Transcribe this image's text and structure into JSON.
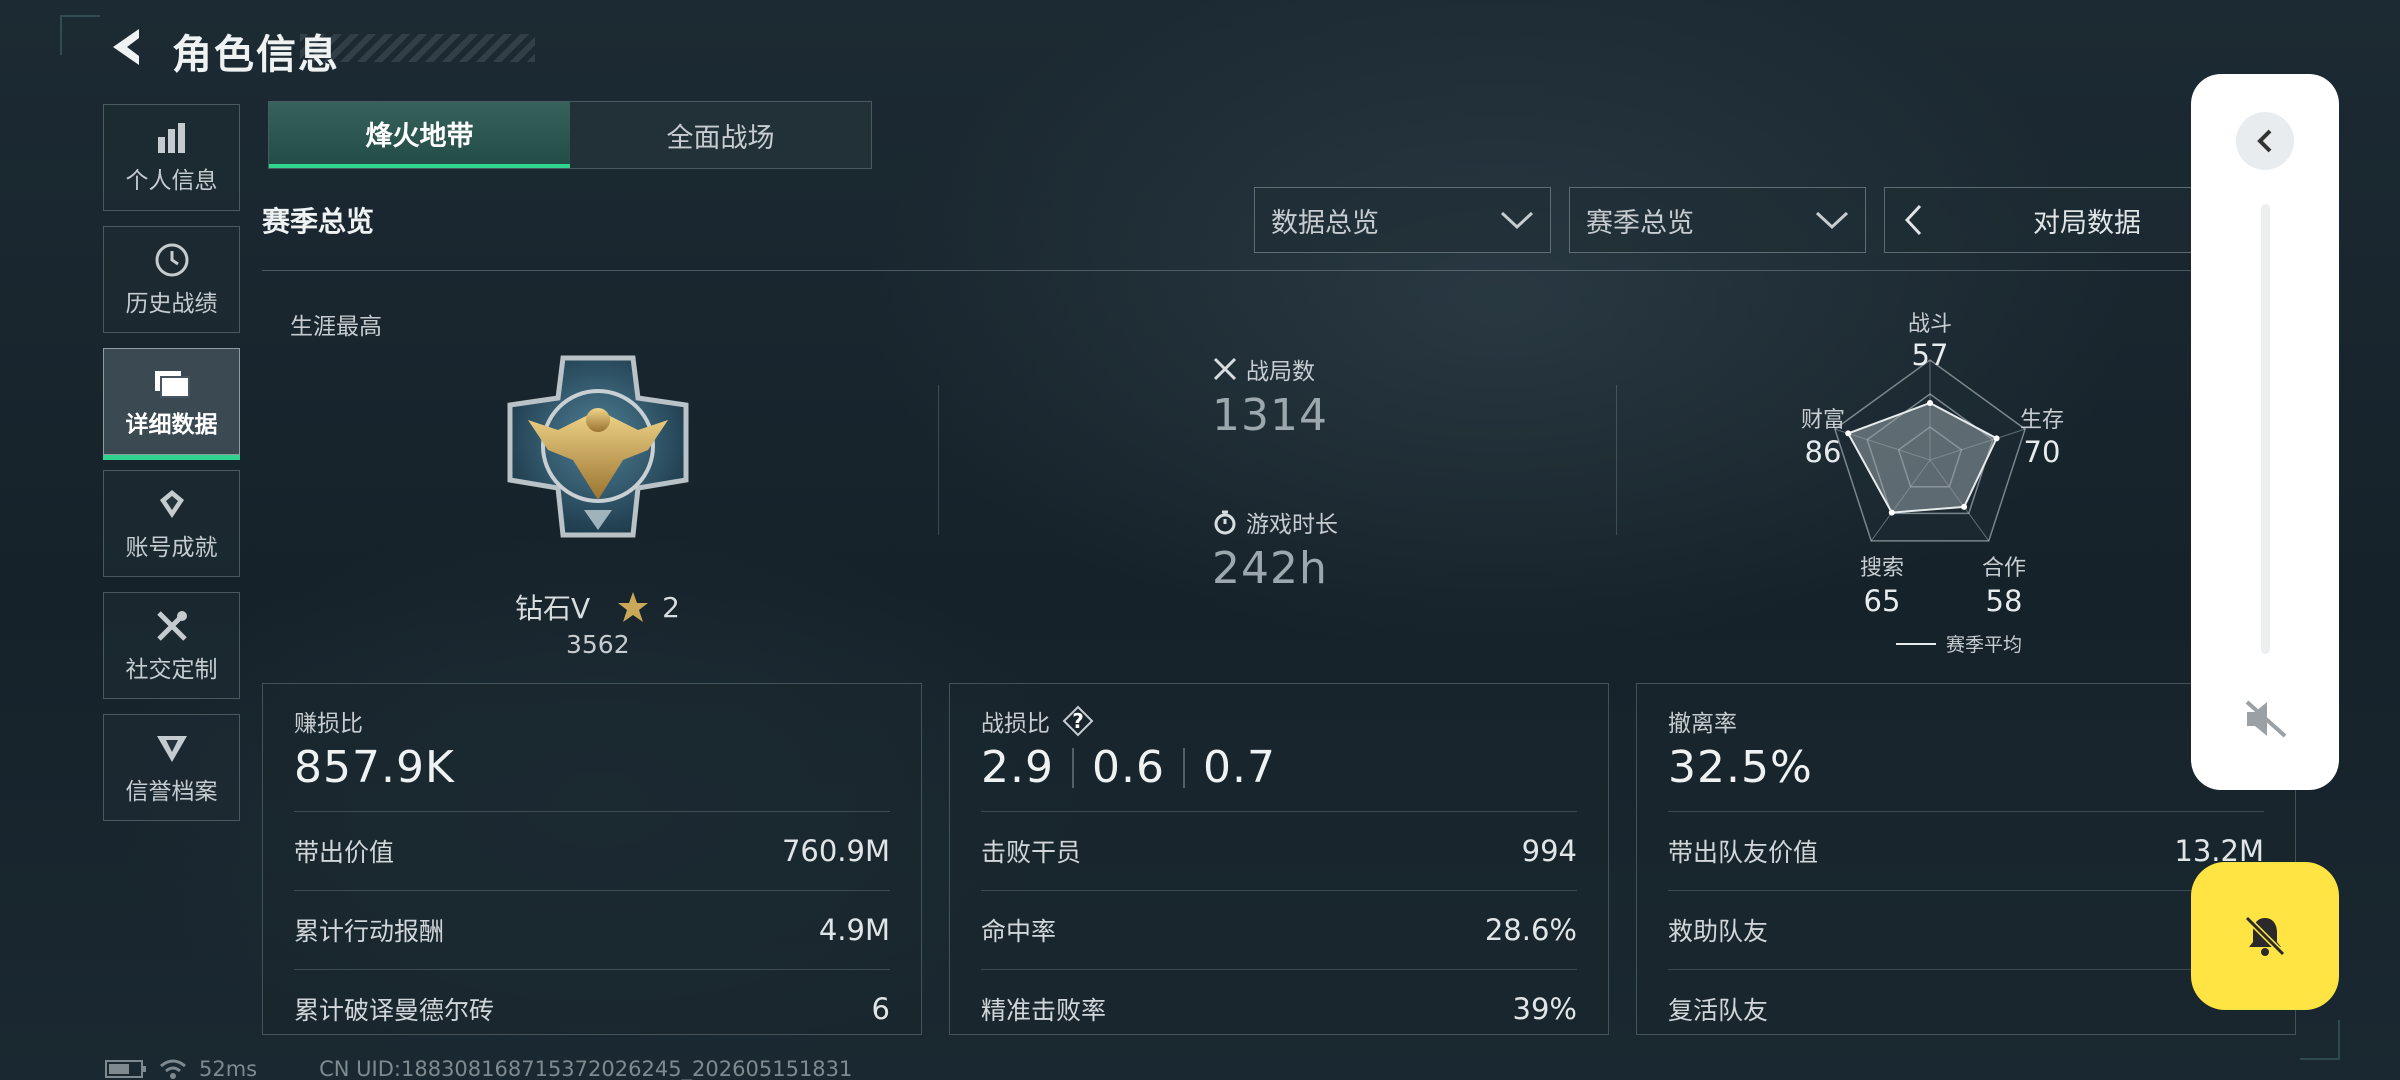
{
  "header": {
    "title": "角色信息"
  },
  "sidebar": {
    "items": [
      {
        "label": "个人信息",
        "icon": "bar-chart-icon"
      },
      {
        "label": "历史战绩",
        "icon": "history-icon"
      },
      {
        "label": "详细数据",
        "icon": "cards-icon",
        "active": true
      },
      {
        "label": "账号成就",
        "icon": "achievement-icon"
      },
      {
        "label": "社交定制",
        "icon": "tools-icon"
      },
      {
        "label": "信誉档案",
        "icon": "credibility-icon"
      }
    ]
  },
  "mode_tabs": [
    {
      "label": "烽火地带",
      "active": true
    },
    {
      "label": "全面战场",
      "active": false
    }
  ],
  "section": {
    "title": "赛季总览"
  },
  "filters": {
    "data_overview": "数据总览",
    "season_overview": "赛季总览",
    "match_data": "对局数据"
  },
  "career": {
    "label": "生涯最高",
    "rank_name": "钻石V",
    "stars": "2",
    "points": "3562"
  },
  "stats": {
    "matches_label": "战局数",
    "matches_value": "1314",
    "playtime_label": "游戏时长",
    "playtime_value": "242h"
  },
  "radar": {
    "combat_label": "战斗",
    "combat_value": "57",
    "survival_label": "生存",
    "survival_value": "70",
    "coop_label": "合作",
    "coop_value": "58",
    "search_label": "搜索",
    "search_value": "65",
    "wealth_label": "财富",
    "wealth_value": "86",
    "legend": "赛季平均",
    "scores": {
      "combat": 57,
      "survival": 70,
      "coop": 58,
      "search": 65,
      "wealth": 86
    }
  },
  "cards": {
    "profit": {
      "title": "赚损比",
      "value": "857.9K",
      "rows": [
        {
          "label": "带出价值",
          "value": "760.9M"
        },
        {
          "label": "累计行动报酬",
          "value": "4.9M"
        },
        {
          "label": "累计破译曼德尔砖",
          "value": "6"
        }
      ]
    },
    "kd": {
      "title": "战损比",
      "help": "?",
      "values": [
        "2.9",
        "0.6",
        "0.7"
      ],
      "rows": [
        {
          "label": "击败干员",
          "value": "994"
        },
        {
          "label": "命中率",
          "value": "28.6%"
        },
        {
          "label": "精准击败率",
          "value": "39%"
        }
      ]
    },
    "extract": {
      "title": "撤离率",
      "value": "32.5%",
      "rows": [
        {
          "label": "带出队友价值",
          "value": "13.2M"
        },
        {
          "label": "救助队友",
          "value": ""
        },
        {
          "label": "复活队友",
          "value": ""
        }
      ]
    }
  },
  "status_bar": {
    "ping": "52ms",
    "uid": "CN UID:188308168715372026245_202605151831"
  },
  "colors": {
    "accent": "#2fd58f",
    "bell_button": "#ffe443"
  }
}
